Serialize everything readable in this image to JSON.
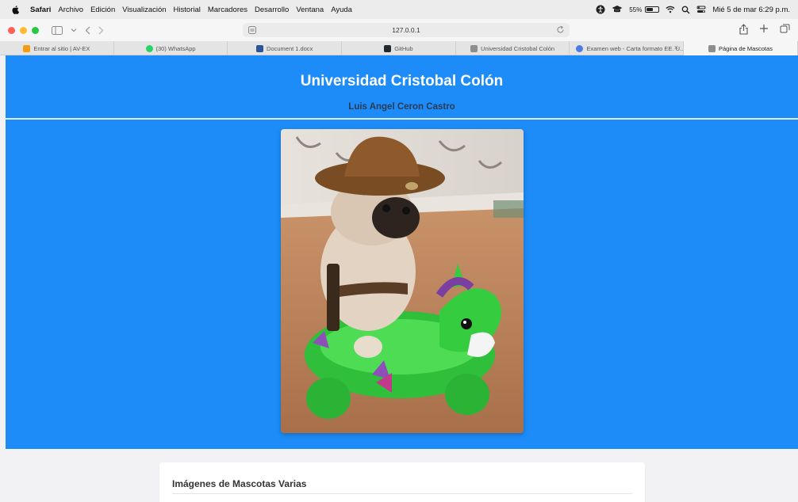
{
  "menubar": {
    "app_name": "Safari",
    "items": [
      "Archivo",
      "Edición",
      "Visualización",
      "Historial",
      "Marcadores",
      "Desarrollo",
      "Ventana",
      "Ayuda"
    ],
    "battery_percent": "55%",
    "battery_level": 0.55,
    "datetime": "Mié 5 de mar  6:29 p.m."
  },
  "toolbar": {
    "address": "127.0.0.1"
  },
  "tabs": [
    {
      "label": "Entrar al sitio | AV-EX",
      "favicon_color": "#f39c12"
    },
    {
      "label": "(30) WhatsApp",
      "favicon_color": "#25d366"
    },
    {
      "label": "Document 1.docx",
      "favicon_color": "#2b579a"
    },
    {
      "label": "GitHub",
      "favicon_color": "#24292e"
    },
    {
      "label": "Universidad Cristobal Colón",
      "favicon_color": "#8e8e8e"
    },
    {
      "label": "Examen web - Carta formato EE. U...",
      "favicon_color": "#4a7de6"
    },
    {
      "label": "Página de Mascotas",
      "favicon_color": "#8e8e8e"
    }
  ],
  "page": {
    "title": "Universidad Cristobal Colón",
    "subtitle": "Luis Angel Ceron Castro",
    "section_title": "Imágenes de Mascotas Varias",
    "primary_color": "#1d8cf8"
  }
}
